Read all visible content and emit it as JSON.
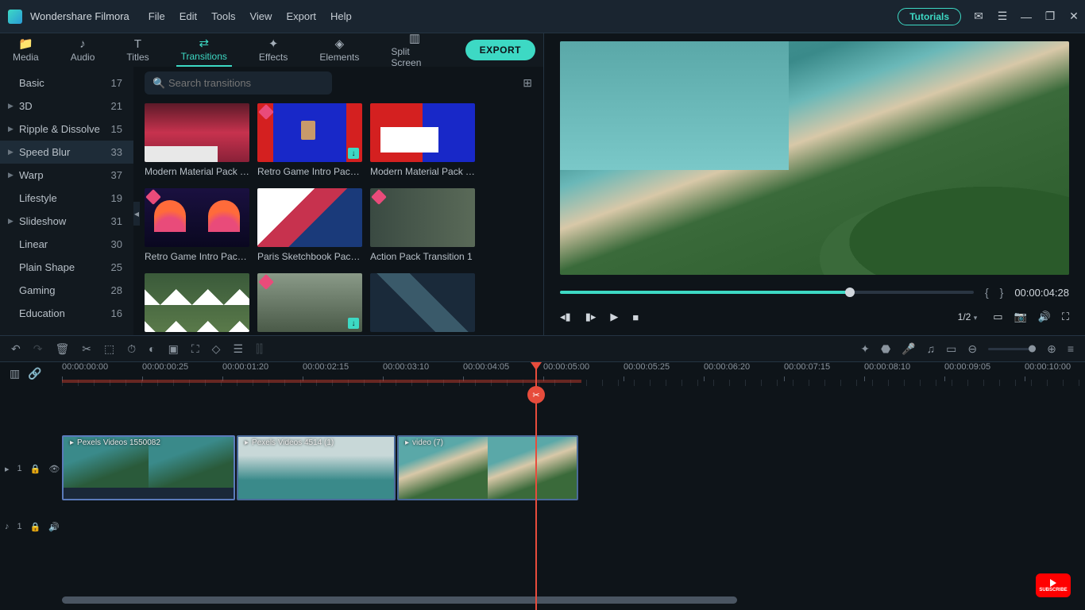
{
  "app": {
    "title": "Wondershare Filmora"
  },
  "menubar": {
    "file": "File",
    "edit": "Edit",
    "tools": "Tools",
    "view": "View",
    "export": "Export",
    "help": "Help"
  },
  "titlebar": {
    "tutorials": "Tutorials"
  },
  "tabs": {
    "media": "Media",
    "audio": "Audio",
    "titles": "Titles",
    "transitions": "Transitions",
    "effects": "Effects",
    "elements": "Elements",
    "split": "Split Screen",
    "export_btn": "EXPORT"
  },
  "search": {
    "placeholder": "Search transitions"
  },
  "categories": [
    {
      "name": "Basic",
      "count": "17",
      "expandable": false
    },
    {
      "name": "3D",
      "count": "21",
      "expandable": true
    },
    {
      "name": "Ripple & Dissolve",
      "count": "15",
      "expandable": true
    },
    {
      "name": "Speed Blur",
      "count": "33",
      "expandable": true
    },
    {
      "name": "Warp",
      "count": "37",
      "expandable": true
    },
    {
      "name": "Lifestyle",
      "count": "19",
      "expandable": false
    },
    {
      "name": "Slideshow",
      "count": "31",
      "expandable": true
    },
    {
      "name": "Linear",
      "count": "30",
      "expandable": false
    },
    {
      "name": "Plain Shape",
      "count": "25",
      "expandable": false
    },
    {
      "name": "Gaming",
      "count": "28",
      "expandable": false
    },
    {
      "name": "Education",
      "count": "16",
      "expandable": false
    }
  ],
  "thumbs": [
    {
      "label": "Modern Material Pack Tr…"
    },
    {
      "label": "Retro Game Intro Pack T…"
    },
    {
      "label": "Modern Material Pack Tr…"
    },
    {
      "label": "Retro Game Intro Pack T…"
    },
    {
      "label": "Paris Sketchbook Pack Tr…"
    },
    {
      "label": "Action Pack Transition 1"
    },
    {
      "label": ""
    },
    {
      "label": ""
    },
    {
      "label": ""
    }
  ],
  "preview": {
    "timecode": "00:00:04:28",
    "ratio": "1/2"
  },
  "ruler": {
    "ticks": [
      "00:00:00:00",
      "00:00:00:25",
      "00:00:01:20",
      "00:00:02:15",
      "00:00:03:10",
      "00:00:04:05",
      "00:00:05:00",
      "00:00:05:25",
      "00:00:06:20",
      "00:00:07:15",
      "00:00:08:10",
      "00:00:09:05",
      "00:00:10:00"
    ]
  },
  "clips": [
    {
      "name": "Pexels Videos 1550082"
    },
    {
      "name": "Pexels Videos 4514 (1)"
    },
    {
      "name": "video (7)"
    }
  ],
  "track": {
    "video_label": "1",
    "audio_label": "1"
  },
  "subscribe": "SUBSCRIBE"
}
